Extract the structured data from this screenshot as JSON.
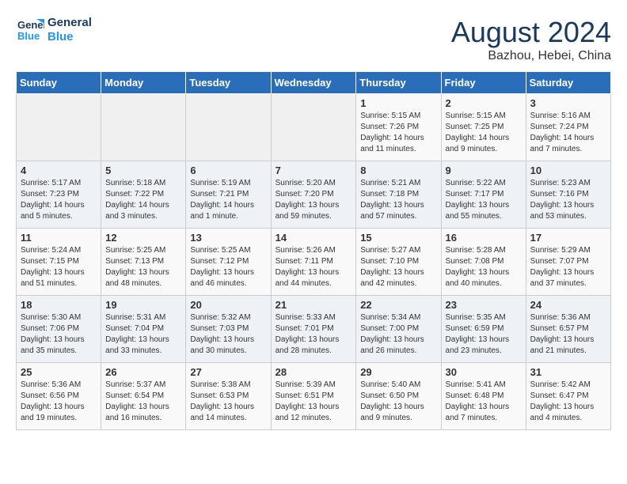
{
  "header": {
    "logo_line1": "General",
    "logo_line2": "Blue",
    "month": "August 2024",
    "location": "Bazhou, Hebei, China"
  },
  "weekdays": [
    "Sunday",
    "Monday",
    "Tuesday",
    "Wednesday",
    "Thursday",
    "Friday",
    "Saturday"
  ],
  "weeks": [
    [
      {
        "day": "",
        "info": ""
      },
      {
        "day": "",
        "info": ""
      },
      {
        "day": "",
        "info": ""
      },
      {
        "day": "",
        "info": ""
      },
      {
        "day": "1",
        "info": "Sunrise: 5:15 AM\nSunset: 7:26 PM\nDaylight: 14 hours\nand 11 minutes."
      },
      {
        "day": "2",
        "info": "Sunrise: 5:15 AM\nSunset: 7:25 PM\nDaylight: 14 hours\nand 9 minutes."
      },
      {
        "day": "3",
        "info": "Sunrise: 5:16 AM\nSunset: 7:24 PM\nDaylight: 14 hours\nand 7 minutes."
      }
    ],
    [
      {
        "day": "4",
        "info": "Sunrise: 5:17 AM\nSunset: 7:23 PM\nDaylight: 14 hours\nand 5 minutes."
      },
      {
        "day": "5",
        "info": "Sunrise: 5:18 AM\nSunset: 7:22 PM\nDaylight: 14 hours\nand 3 minutes."
      },
      {
        "day": "6",
        "info": "Sunrise: 5:19 AM\nSunset: 7:21 PM\nDaylight: 14 hours\nand 1 minute."
      },
      {
        "day": "7",
        "info": "Sunrise: 5:20 AM\nSunset: 7:20 PM\nDaylight: 13 hours\nand 59 minutes."
      },
      {
        "day": "8",
        "info": "Sunrise: 5:21 AM\nSunset: 7:18 PM\nDaylight: 13 hours\nand 57 minutes."
      },
      {
        "day": "9",
        "info": "Sunrise: 5:22 AM\nSunset: 7:17 PM\nDaylight: 13 hours\nand 55 minutes."
      },
      {
        "day": "10",
        "info": "Sunrise: 5:23 AM\nSunset: 7:16 PM\nDaylight: 13 hours\nand 53 minutes."
      }
    ],
    [
      {
        "day": "11",
        "info": "Sunrise: 5:24 AM\nSunset: 7:15 PM\nDaylight: 13 hours\nand 51 minutes."
      },
      {
        "day": "12",
        "info": "Sunrise: 5:25 AM\nSunset: 7:13 PM\nDaylight: 13 hours\nand 48 minutes."
      },
      {
        "day": "13",
        "info": "Sunrise: 5:25 AM\nSunset: 7:12 PM\nDaylight: 13 hours\nand 46 minutes."
      },
      {
        "day": "14",
        "info": "Sunrise: 5:26 AM\nSunset: 7:11 PM\nDaylight: 13 hours\nand 44 minutes."
      },
      {
        "day": "15",
        "info": "Sunrise: 5:27 AM\nSunset: 7:10 PM\nDaylight: 13 hours\nand 42 minutes."
      },
      {
        "day": "16",
        "info": "Sunrise: 5:28 AM\nSunset: 7:08 PM\nDaylight: 13 hours\nand 40 minutes."
      },
      {
        "day": "17",
        "info": "Sunrise: 5:29 AM\nSunset: 7:07 PM\nDaylight: 13 hours\nand 37 minutes."
      }
    ],
    [
      {
        "day": "18",
        "info": "Sunrise: 5:30 AM\nSunset: 7:06 PM\nDaylight: 13 hours\nand 35 minutes."
      },
      {
        "day": "19",
        "info": "Sunrise: 5:31 AM\nSunset: 7:04 PM\nDaylight: 13 hours\nand 33 minutes."
      },
      {
        "day": "20",
        "info": "Sunrise: 5:32 AM\nSunset: 7:03 PM\nDaylight: 13 hours\nand 30 minutes."
      },
      {
        "day": "21",
        "info": "Sunrise: 5:33 AM\nSunset: 7:01 PM\nDaylight: 13 hours\nand 28 minutes."
      },
      {
        "day": "22",
        "info": "Sunrise: 5:34 AM\nSunset: 7:00 PM\nDaylight: 13 hours\nand 26 minutes."
      },
      {
        "day": "23",
        "info": "Sunrise: 5:35 AM\nSunset: 6:59 PM\nDaylight: 13 hours\nand 23 minutes."
      },
      {
        "day": "24",
        "info": "Sunrise: 5:36 AM\nSunset: 6:57 PM\nDaylight: 13 hours\nand 21 minutes."
      }
    ],
    [
      {
        "day": "25",
        "info": "Sunrise: 5:36 AM\nSunset: 6:56 PM\nDaylight: 13 hours\nand 19 minutes."
      },
      {
        "day": "26",
        "info": "Sunrise: 5:37 AM\nSunset: 6:54 PM\nDaylight: 13 hours\nand 16 minutes."
      },
      {
        "day": "27",
        "info": "Sunrise: 5:38 AM\nSunset: 6:53 PM\nDaylight: 13 hours\nand 14 minutes."
      },
      {
        "day": "28",
        "info": "Sunrise: 5:39 AM\nSunset: 6:51 PM\nDaylight: 13 hours\nand 12 minutes."
      },
      {
        "day": "29",
        "info": "Sunrise: 5:40 AM\nSunset: 6:50 PM\nDaylight: 13 hours\nand 9 minutes."
      },
      {
        "day": "30",
        "info": "Sunrise: 5:41 AM\nSunset: 6:48 PM\nDaylight: 13 hours\nand 7 minutes."
      },
      {
        "day": "31",
        "info": "Sunrise: 5:42 AM\nSunset: 6:47 PM\nDaylight: 13 hours\nand 4 minutes."
      }
    ]
  ]
}
